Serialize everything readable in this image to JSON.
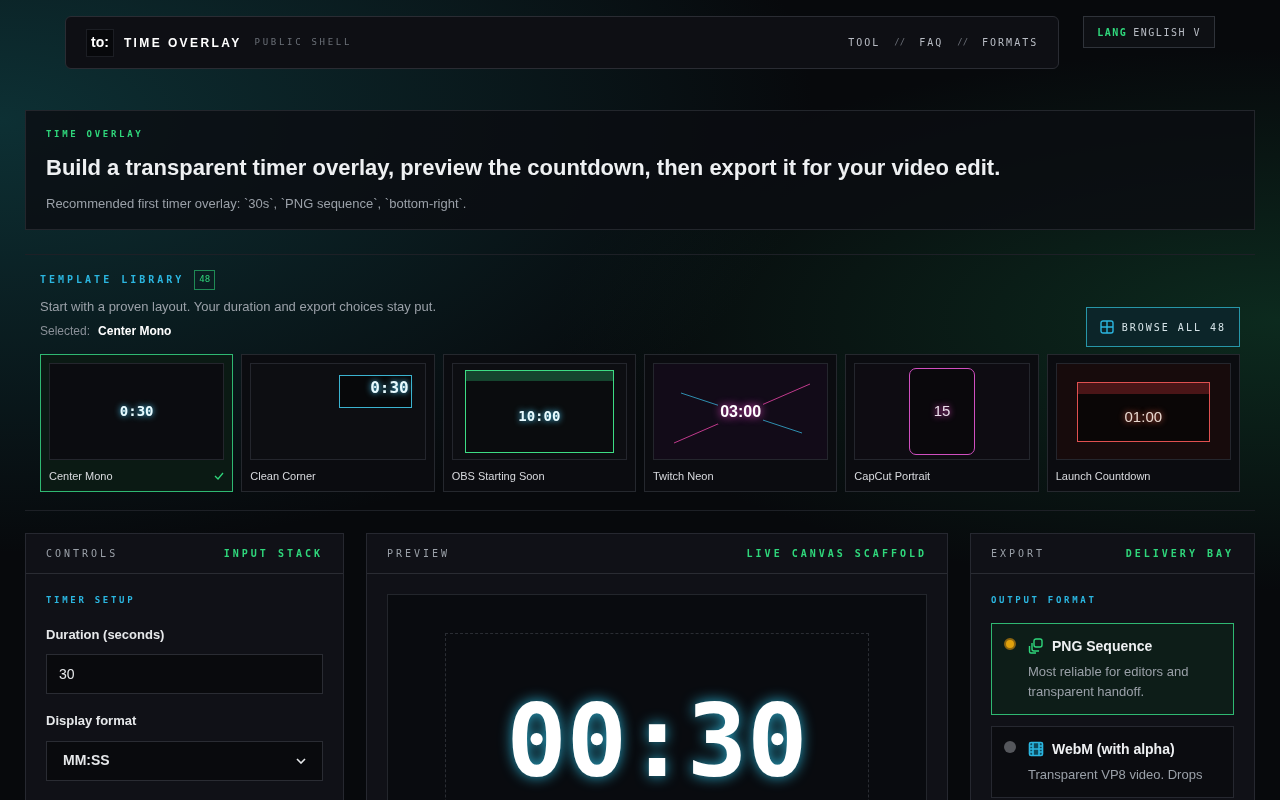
{
  "header": {
    "logo": "to:",
    "title": "TIME OVERLAY",
    "subtitle": "PUBLIC SHELL",
    "nav": [
      {
        "label": "TOOL"
      },
      {
        "label": "FAQ"
      },
      {
        "label": "FORMATS"
      }
    ],
    "nav_separators": [
      "//",
      "//"
    ],
    "lang": {
      "label": "LANG",
      "value": "ENGLISH V"
    }
  },
  "hero": {
    "eyebrow": "TIME OVERLAY",
    "heading": "Build a transparent timer overlay, preview the countdown, then export it for your video edit.",
    "text": "Recommended first timer overlay: `30s`, `PNG sequence`, `bottom-right`."
  },
  "templates": {
    "title": "TEMPLATE LIBRARY",
    "count": "48",
    "text": "Start with a proven layout. Your duration and export choices stay put.",
    "selected_label": "Selected:",
    "selected_value": "Center Mono",
    "browse": "BROWSE ALL 48",
    "items": [
      {
        "kind": "center",
        "name": "Center Mono",
        "time": "0:30",
        "selected": true
      },
      {
        "kind": "corner",
        "name": "Clean Corner",
        "time": "0:30",
        "selected": false
      },
      {
        "kind": "obs",
        "name": "OBS Starting Soon",
        "time": "10:00",
        "selected": false
      },
      {
        "kind": "neon",
        "name": "Twitch Neon",
        "time": "03:00",
        "selected": false
      },
      {
        "kind": "portrait",
        "name": "CapCut Portrait",
        "time": "15",
        "selected": false
      },
      {
        "kind": "launch",
        "name": "Launch Countdown",
        "time": "01:00",
        "selected": false
      }
    ]
  },
  "controls": {
    "title": "CONTROLS",
    "tag": "INPUT STACK",
    "section": "TIMER SETUP",
    "duration_label": "Duration (seconds)",
    "duration_value": "30",
    "format_label": "Display format",
    "format_value": "MM:SS"
  },
  "preview": {
    "title": "PREVIEW",
    "tag": "LIVE CANVAS SCAFFOLD",
    "time": "00:30"
  },
  "export": {
    "title": "EXPORT",
    "tag": "DELIVERY BAY",
    "section": "OUTPUT FORMAT",
    "options": [
      {
        "kind": "png",
        "name": "PNG Sequence",
        "text": "Most reliable for editors and transparent handoff.",
        "selected": true
      },
      {
        "kind": "webm",
        "name": "WebM (with alpha)",
        "text": "Transparent VP8 video. Drops",
        "selected": false
      }
    ]
  }
}
